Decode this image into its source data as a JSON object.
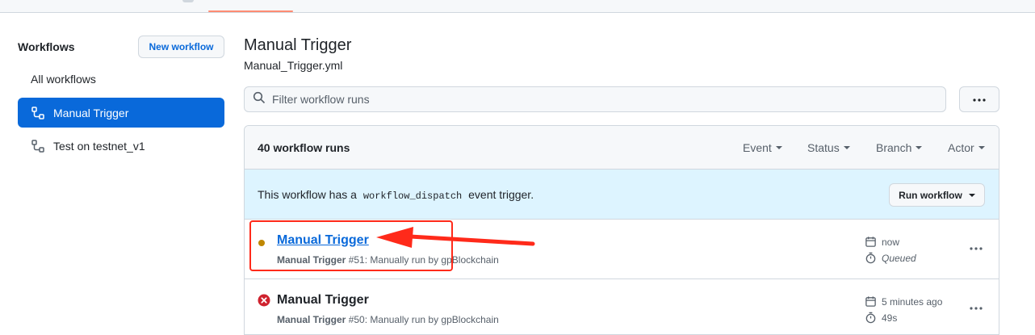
{
  "sidebar": {
    "title": "Workflows",
    "new_workflow_label": "New workflow",
    "all_workflows_label": "All workflows",
    "items": [
      {
        "label": "Manual Trigger",
        "active": true
      },
      {
        "label": "Test on testnet_v1",
        "active": false
      }
    ]
  },
  "main": {
    "title": "Manual Trigger",
    "subtitle": "Manual_Trigger.yml",
    "filter_placeholder": "Filter workflow runs"
  },
  "runs": {
    "count_label": "40 workflow runs",
    "filters": [
      "Event",
      "Status",
      "Branch",
      "Actor"
    ],
    "dispatch_prefix": "This workflow has a",
    "dispatch_code": "workflow_dispatch",
    "dispatch_suffix": "event trigger.",
    "run_workflow_label": "Run workflow",
    "rows": [
      {
        "title": "Manual Trigger",
        "workflow": "Manual Trigger",
        "meta": "#51: Manually run by gpBlockchain",
        "when": "now",
        "duration": "Queued",
        "status": "queued"
      },
      {
        "title": "Manual Trigger",
        "workflow": "Manual Trigger",
        "meta": "#50: Manually run by gpBlockchain",
        "when": "5 minutes ago",
        "duration": "49s",
        "status": "failed"
      }
    ]
  },
  "colors": {
    "accent": "#0969da",
    "banner": "#ddf4ff",
    "queued": "#bf8700",
    "failed": "#cf222e",
    "annotation": "#ff2a1a"
  }
}
